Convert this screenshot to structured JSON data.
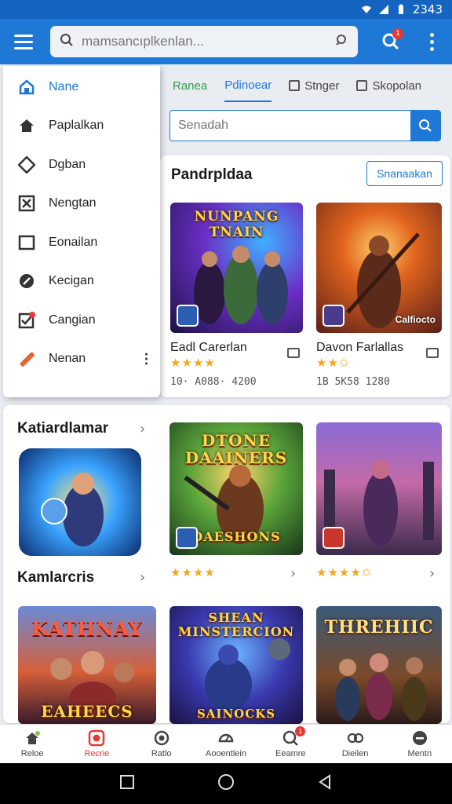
{
  "status_bar": {
    "time": "2343"
  },
  "app_bar": {
    "search_placeholder": "mamsancıplkenlan...",
    "notification_count": "1"
  },
  "tabs": [
    {
      "label": "Ranea"
    },
    {
      "label": "Pdinoear"
    },
    {
      "label": "Stnger"
    },
    {
      "label": "Skopolan"
    }
  ],
  "secondary_search": {
    "placeholder": "Senadah"
  },
  "drawer": {
    "items": [
      {
        "label": "Nane",
        "icon": "home-outline-icon"
      },
      {
        "label": "Paplalkan",
        "icon": "home-icon"
      },
      {
        "label": "Dgban",
        "icon": "diamond-icon"
      },
      {
        "label": "Nengtan",
        "icon": "close-box-icon"
      },
      {
        "label": "Eonailan",
        "icon": "square-icon"
      },
      {
        "label": "Kecigan",
        "icon": "link-icon"
      },
      {
        "label": "Cangian",
        "icon": "check-box-icon"
      },
      {
        "label": "Nenan",
        "icon": "pencil-icon"
      }
    ]
  },
  "featured": {
    "title": "Pandrpldaa",
    "button_label": "Snanaakan",
    "games": [
      {
        "art_title": "NUNPANG TNAIN",
        "name": "Eadl Carerlan",
        "rating": "★★★★",
        "meta": "10· A088· 4200"
      },
      {
        "art_title": "",
        "badge": "Calfiocto",
        "name": "Davon Farlallas",
        "rating": "★★✩",
        "meta": "1B 5K58 1280"
      }
    ]
  },
  "section2": {
    "title": "Katiardlamar",
    "second_title": "Kamlarcris",
    "games": [
      {
        "art_title": "DTONE DAAINERS",
        "art_subtitle": "DAESHONS",
        "rating": "★★★★"
      },
      {
        "art_title": "",
        "rating": "★★★★✩"
      }
    ]
  },
  "section3": {
    "games": [
      {
        "art_title": "KATHNAY",
        "art_subtitle": "EAHEECS"
      },
      {
        "art_title": "SHEAN MINSTERCION",
        "art_subtitle": "SAINOCKS"
      },
      {
        "art_title": "THREHIIC"
      }
    ]
  },
  "bottom_nav": [
    {
      "label": "Reloe"
    },
    {
      "label": "Recrie"
    },
    {
      "label": "Ratlo"
    },
    {
      "label": "Aooentlein"
    },
    {
      "label": "Eeamre",
      "badge": "1"
    },
    {
      "label": "Dieilen"
    },
    {
      "label": "Mentn"
    }
  ],
  "colors": {
    "primary": "#1e78d6",
    "accent": "#e53935",
    "star": "#f4a61c"
  }
}
